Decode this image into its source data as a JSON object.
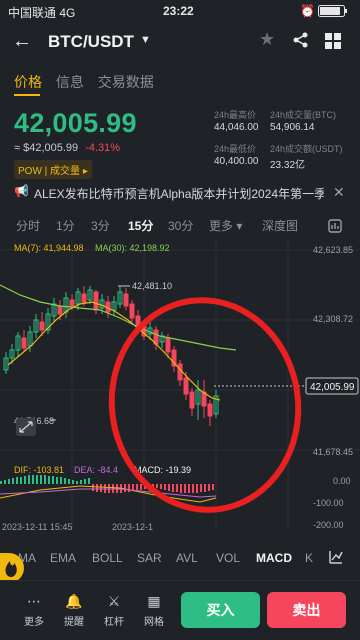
{
  "status_bar": {
    "carrier": "中国联通 4G",
    "time": "23:22"
  },
  "header": {
    "pair": "BTC/USDT"
  },
  "tabs": [
    "价格",
    "信息",
    "交易数据"
  ],
  "price": {
    "last": "42,005.99",
    "fiat": "≈ $42,005.99",
    "change": "-4.31%",
    "tag": "POW | 成交量 ▸"
  },
  "stats": {
    "high_label": "24h最高价",
    "high": "44,046.00",
    "vol_btc_label": "24h成交量(BTC)",
    "vol_btc": "54,906.14",
    "low_label": "24h最低价",
    "low": "40,400.00",
    "vol_usdt_label": "24h成交额(USDT)",
    "vol_usdt": "23.32亿"
  },
  "news": "ALEX发布比特币预言机Alpha版本并计划2024年第一季...",
  "intervals": [
    "分时",
    "1分",
    "3分",
    "15分",
    "30分",
    "更多 ▾",
    "深度图"
  ],
  "chart": {
    "ma7": "MA(7): 41,944.98",
    "ma30": "MA(30): 42,198.92",
    "high_mark": "42,481.10",
    "low_mark": "41,716.68",
    "y_labels": [
      "42,623.85",
      "42,308.72",
      "41,678.45",
      "0.00",
      "-100.00",
      "-200.00"
    ],
    "current": "42,005.99",
    "dif": "DIF: -103.81",
    "dea": "DEA: -84.4",
    "macd": "MACD: -19.39",
    "date1": "2023-12-11 15:45",
    "date2": "2023-12-1"
  },
  "indicators": [
    "MA",
    "EMA",
    "BOLL",
    "SAR",
    "AVL",
    "VOL",
    "MACD",
    "K"
  ],
  "bottom": {
    "more": "更多",
    "alert": "提醒",
    "leverage": "杠杆",
    "grid": "网格",
    "buy": "买入",
    "sell": "卖出"
  },
  "colors": {
    "up": "#2ebd85",
    "down": "#f6465d",
    "accent": "#f0b90b"
  }
}
